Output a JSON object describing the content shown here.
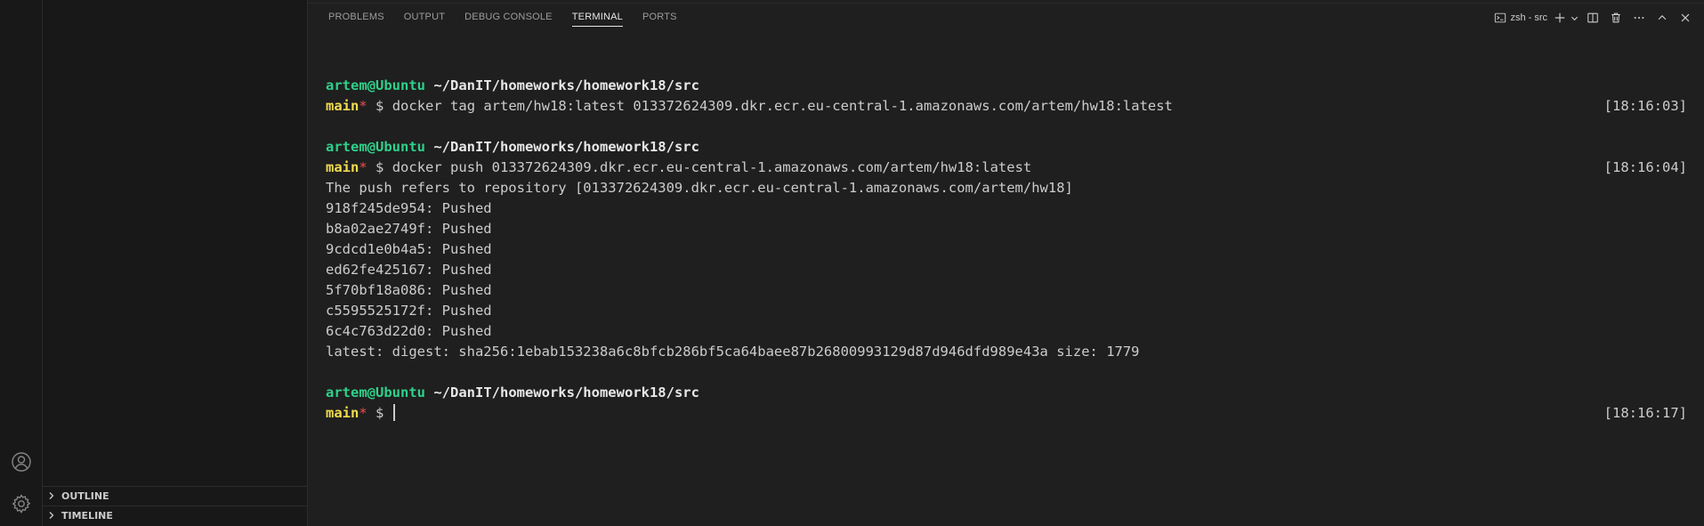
{
  "sidebar": {
    "sections": [
      {
        "label": "OUTLINE"
      },
      {
        "label": "TIMELINE"
      }
    ]
  },
  "activity_bar": {
    "icons": [
      "account-icon",
      "gear-icon"
    ]
  },
  "panel": {
    "tabs": [
      {
        "label": "PROBLEMS",
        "active": false
      },
      {
        "label": "OUTPUT",
        "active": false
      },
      {
        "label": "DEBUG CONSOLE",
        "active": false
      },
      {
        "label": "TERMINAL",
        "active": true
      },
      {
        "label": "PORTS",
        "active": false
      }
    ],
    "terminal_name": "zsh - src"
  },
  "terminal": {
    "prompt_user": "artem@Ubuntu",
    "prompt_path": "~/DanIT/homeworks/homework18/src",
    "branch": "main",
    "dirty_mark": "*",
    "prompt_symbol": "$",
    "blocks": [
      {
        "command": "docker tag artem/hw18:latest 013372624309.dkr.ecr.eu-central-1.amazonaws.com/artem/hw18:latest",
        "time": "[18:16:03]",
        "output": []
      },
      {
        "command": "docker push 013372624309.dkr.ecr.eu-central-1.amazonaws.com/artem/hw18:latest",
        "time": "[18:16:04]",
        "output": [
          "The push refers to repository [013372624309.dkr.ecr.eu-central-1.amazonaws.com/artem/hw18]",
          "918f245de954: Pushed",
          "b8a02ae2749f: Pushed",
          "9cdcd1e0b4a5: Pushed",
          "ed62fe425167: Pushed",
          "5f70bf18a086: Pushed",
          "c5595525172f: Pushed",
          "6c4c763d22d0: Pushed",
          "latest: digest: sha256:1ebab153238a6c8bfcb286bf5ca64baee87b26800993129d87d946dfd989e43a size: 1779"
        ]
      },
      {
        "command": "",
        "time": "[18:16:17]",
        "output": []
      }
    ]
  },
  "colors": {
    "user": "#2fd08a",
    "branch": "#f0dc4e",
    "dirty": "#f14c4c",
    "background": "#1f1f1f"
  }
}
